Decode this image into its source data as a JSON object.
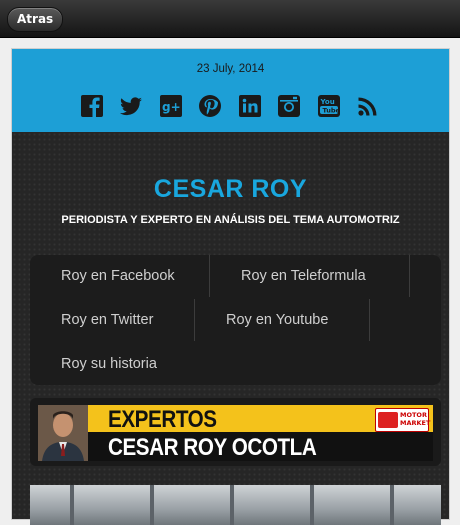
{
  "header": {
    "back_label": "Atras"
  },
  "bluebar": {
    "date": "23 July, 2014",
    "social_icons": [
      "facebook-icon",
      "twitter-icon",
      "google-plus-icon",
      "pinterest-icon",
      "linkedin-icon",
      "instagram-icon",
      "youtube-icon",
      "rss-icon"
    ]
  },
  "site": {
    "title": "CESAR ROY",
    "tagline": "PERIODISTA Y EXPERTO EN ANÁLISIS DEL TEMA AUTOMOTRIZ"
  },
  "menu": {
    "items": [
      {
        "label": "Roy en Facebook"
      },
      {
        "label": "Roy en Teleformula"
      },
      {
        "label": "Roy en Twitter"
      },
      {
        "label": "Roy en Youtube"
      },
      {
        "label": "Roy su historia"
      }
    ]
  },
  "banner": {
    "line1": "EXPERTOS",
    "line2": "CESAR ROY OCOTLA",
    "logo_text_1": "MOTOR",
    "logo_text_2": "MARKET"
  },
  "colors": {
    "accent_blue": "#1d9fd6",
    "title_blue": "#19a7de",
    "banner_yellow": "#f4c21b"
  }
}
